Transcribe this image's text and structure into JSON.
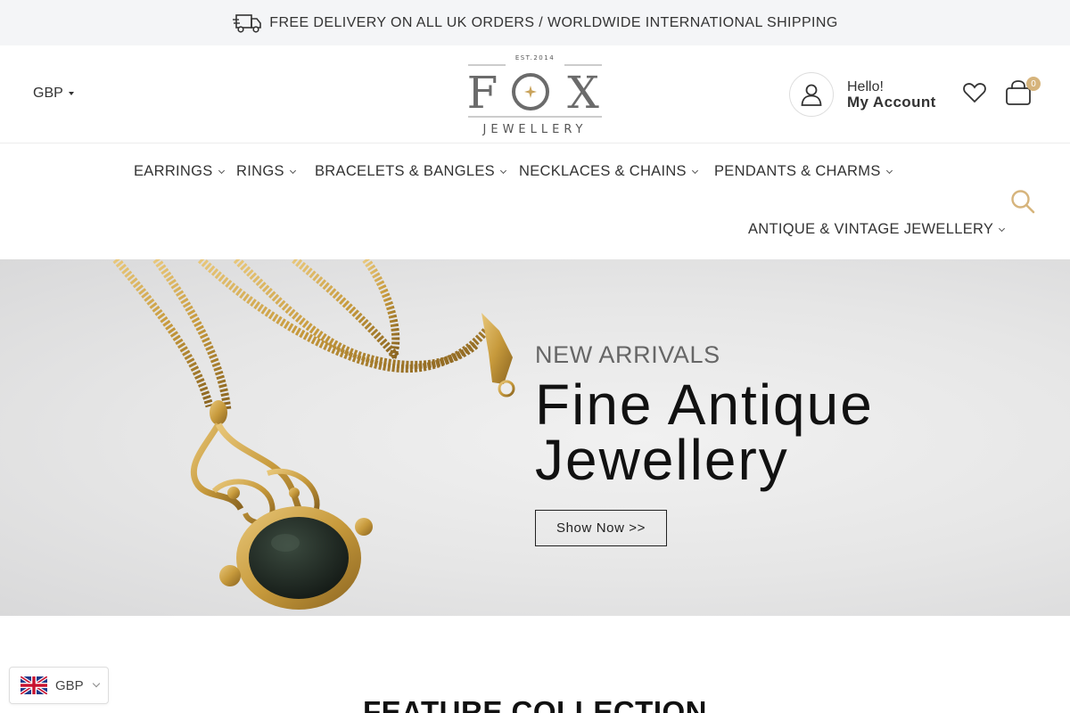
{
  "announcement": {
    "text": "FREE DELIVERY ON ALL UK ORDERS / WORLDWIDE INTERNATIONAL SHIPPING",
    "icon": "truck-icon"
  },
  "header": {
    "currency": "GBP",
    "logo": {
      "est": "EST.2014",
      "letters": [
        "F",
        "O",
        "X"
      ],
      "sub": "JEWELLERY"
    },
    "account": {
      "hello": "Hello!",
      "label": "My Account"
    },
    "cart_count": "0"
  },
  "nav": {
    "items": [
      {
        "label": "EARRINGS"
      },
      {
        "label": "RINGS"
      },
      {
        "label": "BRACELETS & BANGLES"
      },
      {
        "label": "NECKLACES & CHAINS"
      },
      {
        "label": "PENDANTS & CHARMS"
      },
      {
        "label": "ANTIQUE & VINTAGE JEWELLERY"
      }
    ]
  },
  "hero": {
    "kicker": "NEW ARRIVALS",
    "headline_line1": "Fine Antique",
    "headline_line2": "Jewellery",
    "cta": "Show Now >>"
  },
  "feature": {
    "title": "FEATURE COLLECTION"
  },
  "currency_widget": {
    "code": "GBP",
    "flag": "uk-flag-icon"
  },
  "colors": {
    "accent_gold": "#d6b47c",
    "announce_bg": "#f4f5f7",
    "search_icon": "#d6b47c"
  }
}
